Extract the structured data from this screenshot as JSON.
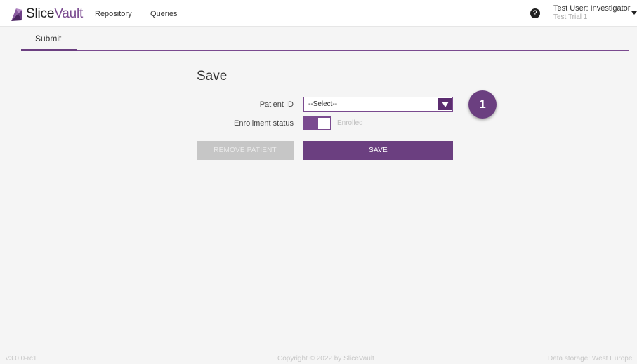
{
  "header": {
    "logo_prefix": "Slice",
    "logo_suffix": "Vault",
    "nav": [
      "Repository",
      "Queries"
    ],
    "help_glyph": "?",
    "user_name": "Test User: Investigator",
    "user_trial": "Test Trial 1"
  },
  "tabs": [
    {
      "label": "Submit",
      "active": true
    }
  ],
  "form": {
    "title": "Save",
    "patient_label": "Patient ID",
    "patient_placeholder": "--Select--",
    "enrollment_label": "Enrollment status",
    "enrollment_value": "Enrolled",
    "enrollment_on": true,
    "remove_label": "REMOVE PATIENT",
    "save_label": "SAVE"
  },
  "step_badge": "1",
  "footer": {
    "version": "v3.0.0-rc1",
    "copyright": "Copyright © 2022 by SliceVault",
    "storage": "Data storage: West Europe"
  },
  "colors": {
    "brand": "#6b3f80",
    "brand_dark": "#5b2c6f",
    "disabled": "#c6c6c6",
    "background": "#f5f5f5"
  },
  "icons": {
    "logo": "slicevault-logo-icon",
    "help": "help-circle-icon",
    "user_menu": "chevron-down-icon",
    "select_arrow": "triangle-down-icon"
  }
}
